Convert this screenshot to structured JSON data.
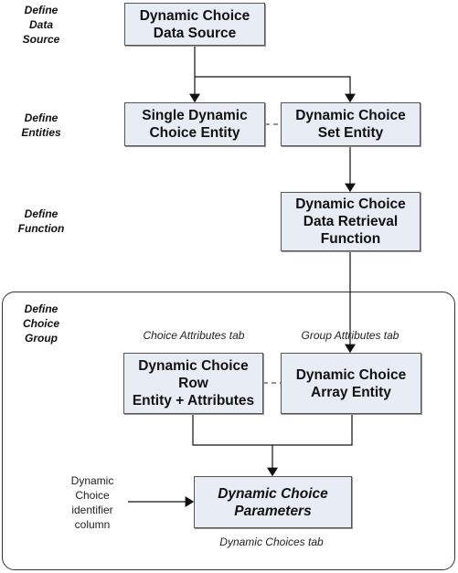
{
  "stages": {
    "data_source": "Define\nData\nSource",
    "entities": "Define\nEntities",
    "function": "Define\nFunction",
    "choice_group": "Define\nChoice\nGroup"
  },
  "boxes": {
    "data_source": "Dynamic Choice\nData Source",
    "single_entity": "Single Dynamic\nChoice Entity",
    "set_entity": "Dynamic Choice\nSet Entity",
    "retrieval_function": "Dynamic Choice\nData Retrieval\nFunction",
    "row_entity": "Dynamic Choice\nRow\nEntity + Attributes",
    "array_entity": "Dynamic Choice\nArray Entity",
    "parameters": "Dynamic Choice\nParameters"
  },
  "tabs": {
    "choice_attributes": "Choice Attributes tab",
    "group_attributes": "Group Attributes tab",
    "dynamic_choices": "Dynamic Choices tab"
  },
  "notes": {
    "identifier": "Dynamic\nChoice\nidentifier\ncolumn"
  },
  "colors": {
    "box_fill": "#e8ecf5",
    "border": "#555555"
  }
}
